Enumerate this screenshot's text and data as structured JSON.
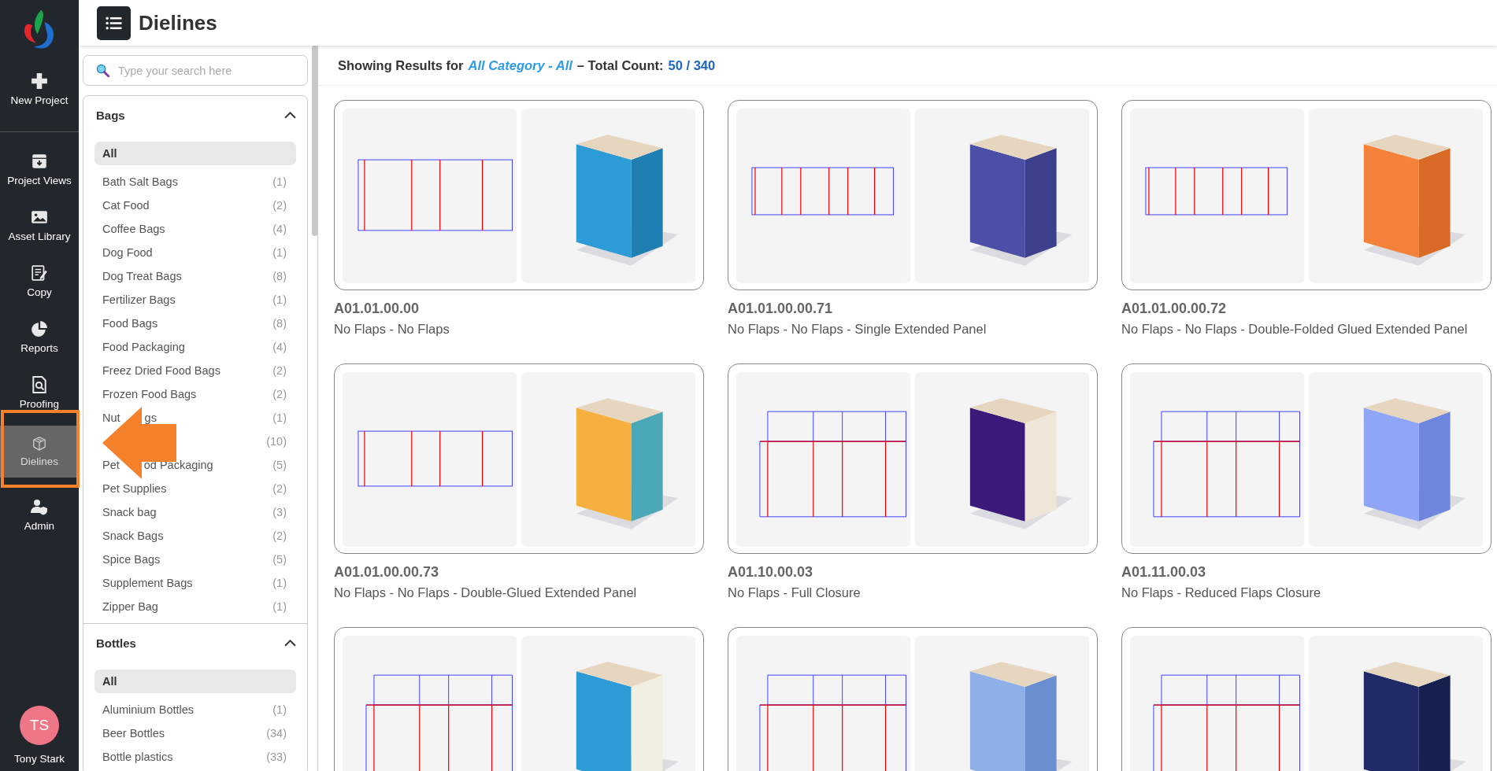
{
  "app": {
    "title": "Dielines"
  },
  "nav": [
    {
      "label": "New Project",
      "selected": false
    },
    {
      "label": "Project Views",
      "selected": false
    },
    {
      "label": "Asset Library",
      "selected": false
    },
    {
      "label": "Copy",
      "selected": false
    },
    {
      "label": "Reports",
      "selected": false
    },
    {
      "label": "Proofing",
      "selected": false
    },
    {
      "label": "Dielines",
      "selected": true
    },
    {
      "label": "Admin",
      "selected": false
    }
  ],
  "user": {
    "initials": "TS",
    "name": "Tony Stark"
  },
  "search": {
    "placeholder": "Type your search here"
  },
  "categories": [
    {
      "name": "Bags",
      "expanded": true,
      "items": [
        {
          "label": "All",
          "selected": true
        },
        {
          "label": "Bath Salt Bags",
          "count": "(1)",
          "selected": false
        },
        {
          "label": "Cat Food",
          "count": "(2)",
          "selected": false
        },
        {
          "label": "Coffee Bags",
          "count": "(4)",
          "selected": false
        },
        {
          "label": "Dog Food",
          "count": "(1)",
          "selected": false
        },
        {
          "label": "Dog Treat Bags",
          "count": "(8)",
          "selected": false
        },
        {
          "label": "Fertilizer Bags",
          "count": "(1)",
          "selected": false
        },
        {
          "label": "Food Bags",
          "count": "(8)",
          "selected": false
        },
        {
          "label": "Food Packaging",
          "count": "(4)",
          "selected": false
        },
        {
          "label": "Freez Dried Food Bags",
          "count": "(2)",
          "selected": false
        },
        {
          "label": "Frozen Food Bags",
          "count": "(2)",
          "selected": false
        },
        {
          "label": "Nut",
          "tail": "gs",
          "count": "(1)",
          "selected": false
        },
        {
          "count": "(10)",
          "selected": false
        },
        {
          "label": "Pet",
          "tail": "od Packaging",
          "count": "(5)",
          "selected": false
        },
        {
          "label": "Pet Supplies",
          "count": "(2)",
          "selected": false
        },
        {
          "label": "Snack bag",
          "count": "(3)",
          "selected": false
        },
        {
          "label": "Snack Bags",
          "count": "(2)",
          "selected": false
        },
        {
          "label": "Spice Bags",
          "count": "(5)",
          "selected": false
        },
        {
          "label": "Supplement Bags",
          "count": "(1)",
          "selected": false
        },
        {
          "label": "Zipper Bag",
          "count": "(1)",
          "selected": false
        }
      ]
    },
    {
      "name": "Bottles",
      "expanded": true,
      "items": [
        {
          "label": "All",
          "selected": true
        },
        {
          "label": "Aluminium Bottles",
          "count": "(1)",
          "selected": false
        },
        {
          "label": "Beer Bottles",
          "count": "(34)",
          "selected": false
        },
        {
          "label": "Bottle plastics",
          "count": "(33)",
          "selected": false
        }
      ]
    }
  ],
  "results": {
    "prefix": "Showing Results for",
    "category": "All Category - All",
    "count_label": "– Total Count:",
    "count": "50 / 340"
  },
  "cards": [
    {
      "code": "A01.01.00.00",
      "description": "No Flaps - No Flaps"
    },
    {
      "code": "A01.01.00.00.71",
      "description": "No Flaps - No Flaps - Single Extended Panel"
    },
    {
      "code": "A01.01.00.00.72",
      "description": "No Flaps - No Flaps - Double-Folded Glued Extended Panel"
    },
    {
      "code": "A01.01.00.00.73",
      "description": "No Flaps - No Flaps - Double-Glued Extended Panel"
    },
    {
      "code": "A01.10.00.03",
      "description": "No Flaps - Full Closure"
    },
    {
      "code": "A01.11.00.03",
      "description": "No Flaps - Reduced Flaps Closure"
    }
  ]
}
